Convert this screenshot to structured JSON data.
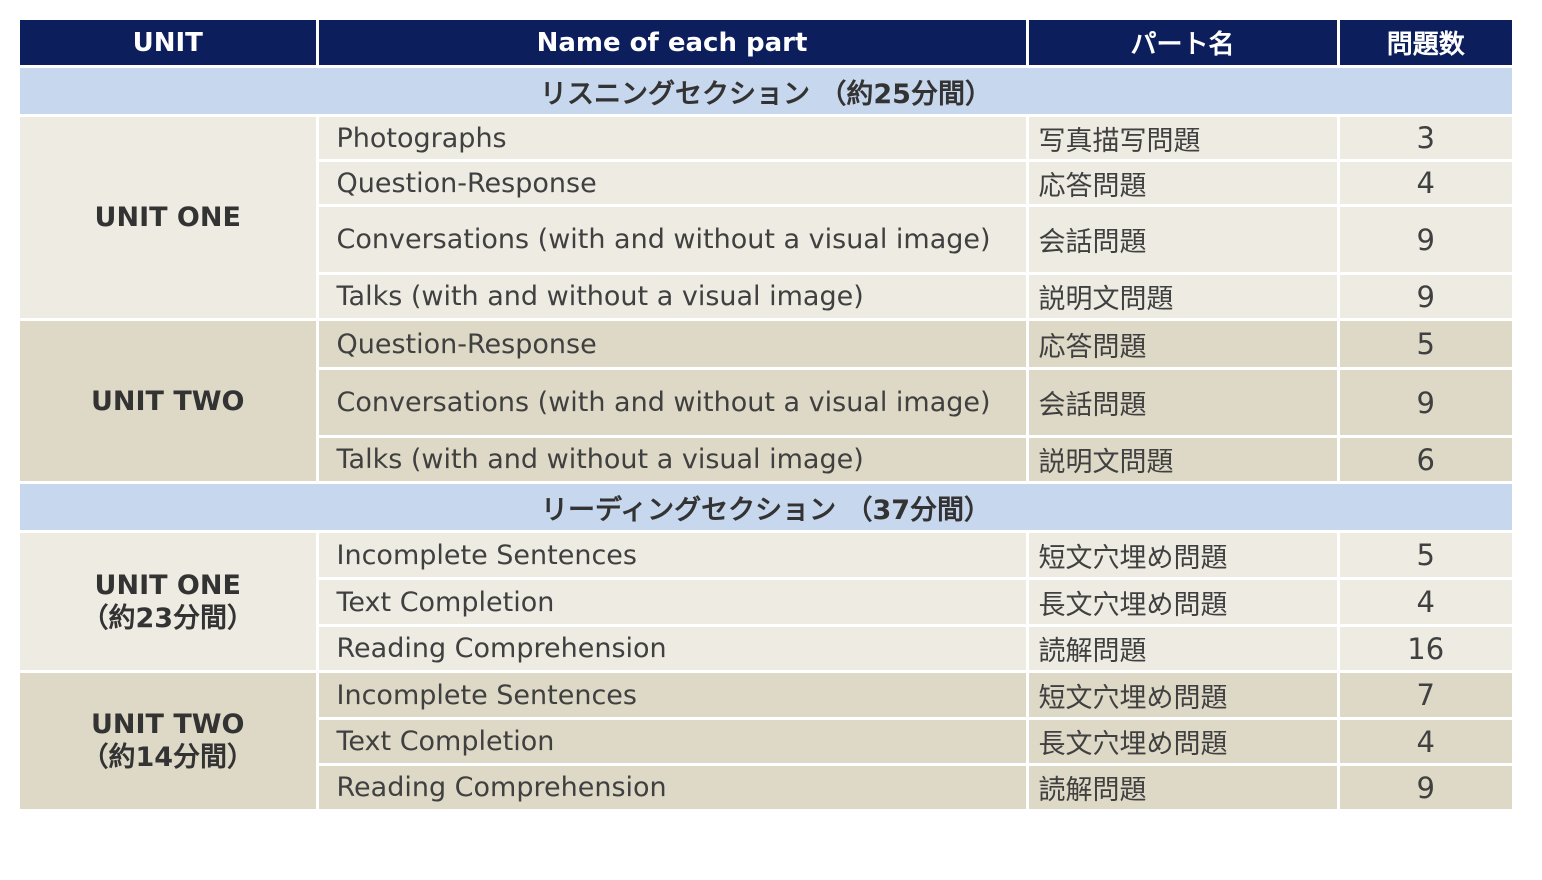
{
  "headers": {
    "unit": "UNIT",
    "name": "Name of each part",
    "part_jp": "パート名",
    "count": "問題数"
  },
  "sections": [
    {
      "title": "リスニングセクション （約25分間）",
      "units": [
        {
          "label": "UNIT ONE",
          "sub": "",
          "rows": [
            {
              "name": "Photographs",
              "jp": "写真描写問題",
              "count": "3"
            },
            {
              "name": "Question-Response",
              "jp": "応答問題",
              "count": "4"
            },
            {
              "name": "Conversations (with and without a visual image)",
              "jp": "会話問題",
              "count": "9"
            },
            {
              "name": "Talks (with and without a visual image)",
              "jp": "説明文問題",
              "count": "9"
            }
          ]
        },
        {
          "label": "UNIT TWO",
          "sub": "",
          "rows": [
            {
              "name": "Question-Response",
              "jp": "応答問題",
              "count": "5"
            },
            {
              "name": "Conversations (with and without a visual image)",
              "jp": "会話問題",
              "count": "9"
            },
            {
              "name": "Talks (with and without a visual image)",
              "jp": "説明文問題",
              "count": "6"
            }
          ]
        }
      ]
    },
    {
      "title": "リーディングセクション （37分間）",
      "units": [
        {
          "label": "UNIT ONE",
          "sub": "（約23分間）",
          "rows": [
            {
              "name": "Incomplete Sentences",
              "jp": "短文穴埋め問題",
              "count": "5"
            },
            {
              "name": "Text Completion",
              "jp": "長文穴埋め問題",
              "count": "4"
            },
            {
              "name": "Reading Comprehension",
              "jp": "読解問題",
              "count": "16"
            }
          ]
        },
        {
          "label": "UNIT TWO",
          "sub": "（約14分間）",
          "rows": [
            {
              "name": "Incomplete Sentences",
              "jp": "短文穴埋め問題",
              "count": "7"
            },
            {
              "name": "Text Completion",
              "jp": "長文穴埋め問題",
              "count": "4"
            },
            {
              "name": "Reading Comprehension",
              "jp": "読解問題",
              "count": "9"
            }
          ]
        }
      ]
    }
  ]
}
